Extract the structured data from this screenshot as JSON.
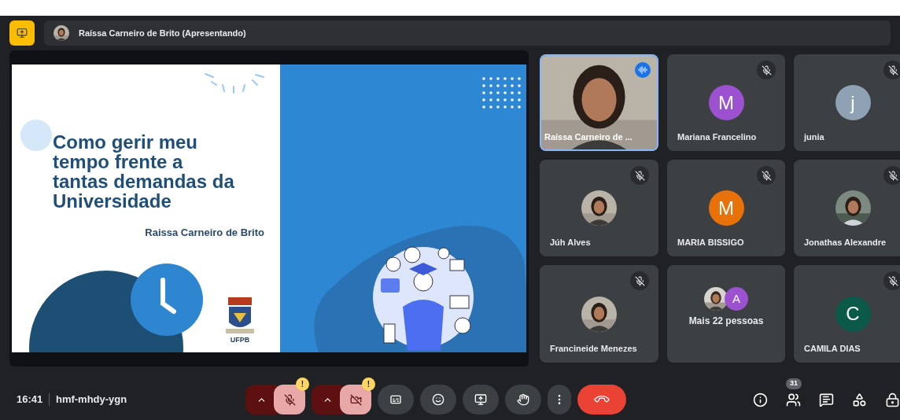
{
  "top_bar": {
    "presenter": "Raíssa Carneiro de Brito (Apresentando)"
  },
  "slide": {
    "title": "Como gerir meu tempo frente a tantas demandas da Universidade",
    "author": "Raissa Carneiro de Brito",
    "logo_label": "UFPB"
  },
  "tiles": [
    {
      "kind": "video",
      "name": "Raíssa Carneiro de ...",
      "speaking": true,
      "muted": false
    },
    {
      "kind": "initial",
      "name": "Mariana Francelino",
      "initial": "M",
      "color": "#9b51d0",
      "muted": true
    },
    {
      "kind": "initial",
      "name": "junia",
      "initial": "j",
      "color": "#8ea2b4",
      "muted": true
    },
    {
      "name": "Júh Alves",
      "muted": true
    },
    {
      "kind": "initial",
      "name": "MARIA BISSIGO",
      "initial": "M",
      "color": "#e8710a",
      "muted": true
    },
    {
      "name": "Jonathas Alexandre",
      "muted": true
    },
    {
      "name": "Francineide Menezes",
      "muted": true
    },
    {
      "kind": "more",
      "name": "Mais 22 pessoas",
      "initial": "A",
      "color": "#9b51d0",
      "muted": false
    },
    {
      "kind": "initial",
      "name": "CAMILA DIAS",
      "initial": "C",
      "color": "#0b5a49",
      "muted": true
    }
  ],
  "bottom_bar": {
    "time": "16:41",
    "meeting_code": "hmf-mhdy-ygn",
    "controls": [
      {
        "kind": "mic",
        "off": true,
        "badge": "!"
      },
      {
        "kind": "camera",
        "off": true,
        "badge": "!"
      },
      {
        "kind": "captions"
      },
      {
        "kind": "emoji"
      },
      {
        "kind": "present"
      },
      {
        "kind": "hand"
      },
      {
        "kind": "more"
      },
      {
        "kind": "hangup"
      }
    ],
    "side_tools": [
      {
        "kind": "info"
      },
      {
        "kind": "people",
        "badge": "31"
      },
      {
        "kind": "chat"
      },
      {
        "kind": "activities"
      },
      {
        "kind": "lock"
      }
    ]
  }
}
